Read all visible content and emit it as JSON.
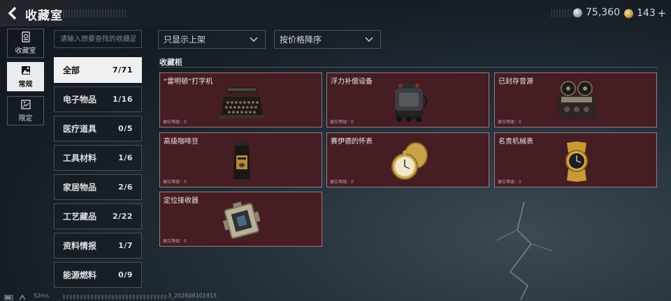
{
  "header": {
    "title": "收藏室",
    "currencies": [
      {
        "icon": "silver-coin-icon",
        "value": "75,360"
      },
      {
        "icon": "gold-coin-icon",
        "value": "143"
      }
    ],
    "plus": "+"
  },
  "left_tabs": [
    {
      "label": "收藏室",
      "icon": "collection-room-icon",
      "active": false
    },
    {
      "label": "常规",
      "icon": "regular-icon",
      "active": true
    },
    {
      "label": "限定",
      "icon": "limited-icon",
      "active": false
    }
  ],
  "search": {
    "placeholder": "请输入想要查找的收藏品",
    "value": ""
  },
  "filters": {
    "display": {
      "selected": "只显示上架"
    },
    "sort": {
      "selected": "按价格降序"
    }
  },
  "categories": [
    {
      "label": "全部",
      "count": "7/71",
      "active": true
    },
    {
      "label": "电子物品",
      "count": "1/16"
    },
    {
      "label": "医疗道具",
      "count": "0/5"
    },
    {
      "label": "工具材料",
      "count": "1/6"
    },
    {
      "label": "家居物品",
      "count": "2/6"
    },
    {
      "label": "工艺藏品",
      "count": "2/22"
    },
    {
      "label": "资料情报",
      "count": "1/7"
    },
    {
      "label": "能源燃料",
      "count": "0/9"
    }
  ],
  "cabinet": {
    "title": "收藏柜",
    "level_label": "展位等级：0",
    "items": [
      {
        "name": "“雷明顿”打字机",
        "icon": "typewriter-icon"
      },
      {
        "name": "浮力补偿设备",
        "icon": "buoyancy-compensator-icon"
      },
      {
        "name": "已封存音源",
        "icon": "reel-to-reel-recorder-icon"
      },
      {
        "name": "高级咖啡豆",
        "icon": "coffee-bean-bag-icon"
      },
      {
        "name": "赛伊德的怀表",
        "icon": "pocket-watch-icon"
      },
      {
        "name": "名贵机械表",
        "icon": "wristwatch-icon"
      },
      {
        "name": "定位接收器",
        "icon": "locator-receiver-icon"
      }
    ]
  },
  "footer": {
    "ping": "52ms",
    "version": "3_202608101915"
  },
  "colors": {
    "card_background": "#451d23",
    "active_tab": "#eef0f1"
  }
}
